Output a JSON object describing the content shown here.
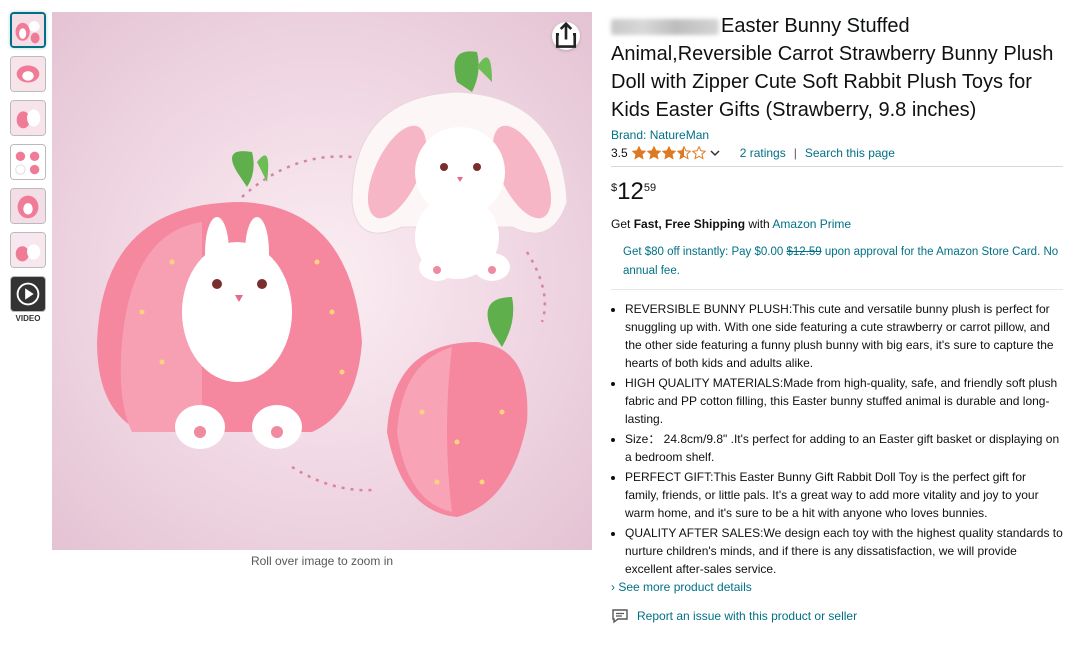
{
  "gallery": {
    "thumbnails": [
      "thumb-1",
      "thumb-2",
      "thumb-3",
      "thumb-4",
      "thumb-5",
      "thumb-6"
    ],
    "video_label": "VIDEO",
    "zoom_hint": "Roll over image to zoom in",
    "share_icon": "share-icon"
  },
  "product": {
    "title": "Easter Bunny Stuffed Animal,Reversible Carrot Strawberry Bunny Plush Doll with Zipper Cute Soft Rabbit Plush Toys for Kids Easter Gifts (Strawberry, 9.8 inches)",
    "brand": "Brand: NatureMan",
    "rating_value": "3.5",
    "rating_stars": 3.5,
    "ratings_link": "2 ratings",
    "search_link": "Search this page",
    "separator": "|",
    "price": {
      "symbol": "$",
      "whole": "12",
      "fraction": "59"
    },
    "shipping": {
      "prefix": "Get ",
      "bold": "Fast, Free Shipping",
      "middle": " with ",
      "link": "Amazon Prime"
    },
    "card_offer": {
      "text1": "Get $80 off instantly: Pay $0.00 ",
      "strike": "$12.59",
      "text2": " upon approval for the Amazon Store Card. No annual fee."
    },
    "bullets": [
      "REVERSIBLE BUNNY PLUSH:This cute and versatile bunny plush is perfect for snuggling up with. With one side featuring a cute strawberry or carrot pillow, and the other side featuring a funny plush bunny with big ears, it's sure to capture the hearts of both kids and adults alike.",
      "HIGH QUALITY MATERIALS:Made from high-quality, safe, and friendly soft plush fabric and PP cotton filling, this Easter bunny stuffed animal is durable and long-lasting.",
      "Size： 24.8cm/9.8\" .It's perfect for adding to an Easter gift basket or displaying on a bedroom shelf.",
      "PERFECT GIFT:This Easter Bunny Gift Rabbit Doll Toy is the perfect gift for family, friends, or little pals. It's a great way to add more vitality and joy to your warm home, and it's sure to be a hit with anyone who loves bunnies.",
      "QUALITY AFTER SALES:We design each toy with the highest quality standards to nurture children's minds, and if there is any dissatisfaction, we will provide excellent after-sales service."
    ],
    "see_more": "› See more product details",
    "report": "Report an issue with this product or seller"
  },
  "colors": {
    "link": "#007185",
    "star": "#de7921",
    "strawberry": "#f07b96",
    "leaf": "#5fb04d"
  }
}
